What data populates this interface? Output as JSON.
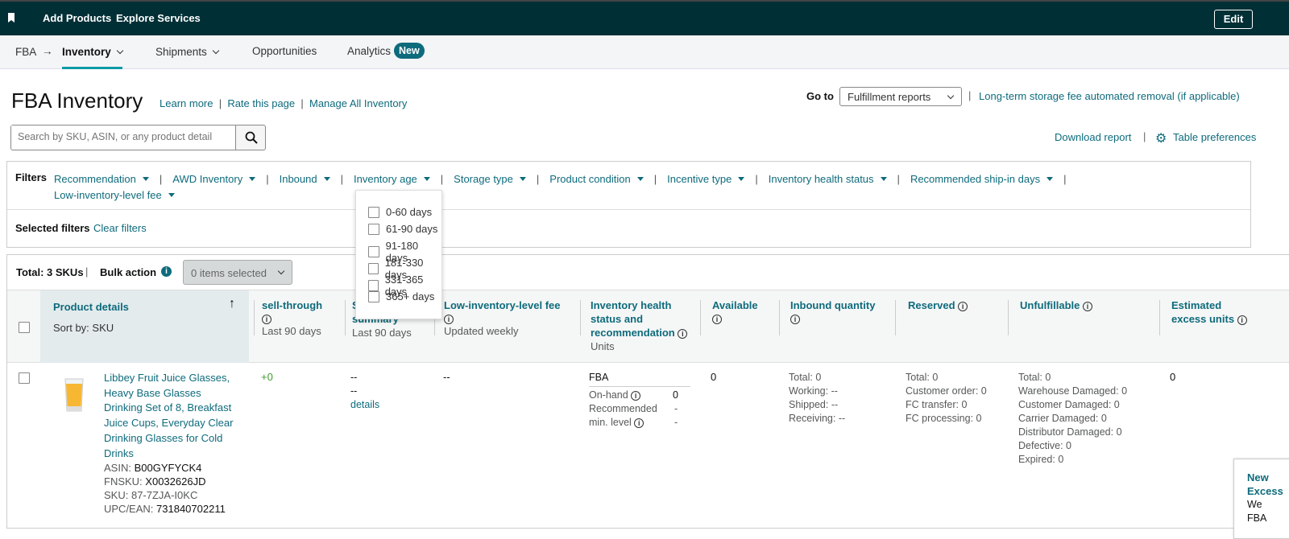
{
  "topbar": {
    "add_products": "Add Products",
    "explore_services": "Explore Services",
    "edit": "Edit"
  },
  "subnav": {
    "fba": "FBA",
    "inventory": "Inventory",
    "shipments": "Shipments",
    "opportunities": "Opportunities",
    "analytics": "Analytics",
    "new_badge": "New"
  },
  "page": {
    "title": "FBA Inventory",
    "learn_more": "Learn more",
    "rate": "Rate this page",
    "manage": "Manage All Inventory",
    "goto_label": "Go to",
    "goto_value": "Fulfillment reports",
    "long_term": "Long-term storage fee automated removal (if applicable)",
    "search_placeholder": "Search by SKU, ASIN, or any product detail",
    "download": "Download report",
    "table_prefs": "Table preferences"
  },
  "filters": {
    "label": "Filters",
    "items": [
      "Recommendation",
      "AWD Inventory",
      "Inbound",
      "Inventory age",
      "Storage type",
      "Product condition",
      "Incentive type",
      "Inventory health status",
      "Recommended ship-in days",
      "Low-inventory-level fee"
    ],
    "selected_label": "Selected filters",
    "clear": "Clear filters"
  },
  "age_dropdown": {
    "options": [
      "0-60 days",
      "61-90 days",
      "91-180 days",
      "181-330 days",
      "331-365 days",
      "365+ days"
    ]
  },
  "table": {
    "total": "Total: 3 SKUs",
    "bulk": "Bulk action",
    "items_selected": "0 items selected",
    "headers": {
      "product": "Product details",
      "sort": "Sort by: SKU",
      "sell": "sell-through",
      "sell_sub": "Last 90 days",
      "sales": "Sales summary",
      "sales_sub": "Last 90 days",
      "low": "Low-inventory-level fee",
      "low_sub": "Updated weekly",
      "health": "Inventory health status and recommendation",
      "health_sub": "Units",
      "available": "Available",
      "inbound": "Inbound quantity",
      "reserved": "Reserved",
      "unfulfillable": "Unfulfillable",
      "excess": "Estimated excess units"
    },
    "row": {
      "title": "Libbey Fruit Juice Glasses, Heavy Base Glasses Drinking Set of 8, Breakfast Juice Cups, Everyday Clear Drinking Glasses for Cold Drinks",
      "asin_l": "ASIN:",
      "asin": "B00GYFYCK4",
      "fnsku_l": "FNSKU:",
      "fnsku": "X0032626JD",
      "sku_l": "SKU:",
      "sku": "87-7ZJA-I0KC",
      "upc_l": "UPC/EAN:",
      "upc": "731840702211",
      "sell": "+0",
      "sales1": "--",
      "sales2": "--",
      "details": "details",
      "low": "--",
      "fba": "FBA",
      "onhand_l": "On-hand",
      "onhand": "0",
      "rec_l1": "Recommended",
      "rec_l2": "min. level",
      "rec1": "-",
      "rec2": "-",
      "available": "0",
      "inbound": [
        "Total:  0",
        "Working: --",
        "Shipped: --",
        "Receiving: --"
      ],
      "reserved": [
        "Total:  0",
        "Customer order:  0",
        "FC transfer:  0",
        "FC processing:  0"
      ],
      "unfulfillable": [
        "Total:  0",
        "Warehouse Damaged:  0",
        "Customer Damaged:  0",
        "Carrier Damaged:  0",
        "Distributor Damaged:  0",
        "Defective:  0",
        "Expired:  0"
      ],
      "excess": "0"
    }
  },
  "side_card": {
    "l1": "New",
    "l2": "Excess",
    "l3": "We",
    "l4": "FBA"
  }
}
